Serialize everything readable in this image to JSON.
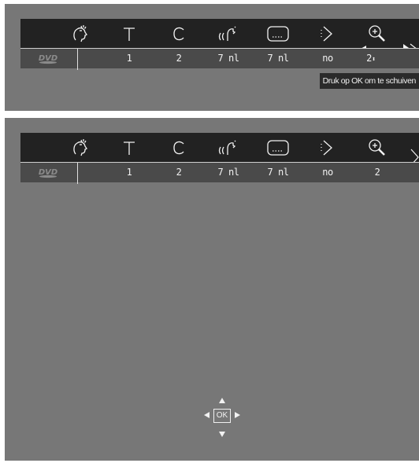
{
  "top_panel": {
    "values": [
      "1",
      "2",
      "7 nl",
      "7 nl",
      "no",
      "2"
    ],
    "zoom_spin": "⬍",
    "tooltip": "Druk op OK om te schuiven"
  },
  "bottom_panel": {
    "values": [
      "1",
      "2",
      "7 nl",
      "7 nl",
      "no",
      "2"
    ],
    "ok_label": "OK"
  },
  "icons": [
    "face-menu-icon",
    "title-icon",
    "chapter-icon",
    "audio-language-icon",
    "subtitle-icon",
    "angle-icon",
    "zoom-icon"
  ],
  "colors": {
    "panel_bg": "#777777",
    "icon_bar": "#222222",
    "value_bar": "#4a4a4a",
    "text": "#f2f2f2"
  }
}
